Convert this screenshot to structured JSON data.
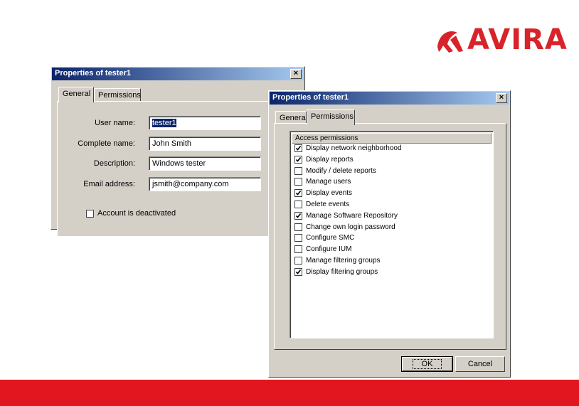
{
  "logo": {
    "text": "AVIRA",
    "brand_color": "#d8232a"
  },
  "footer": {
    "color": "#e2161e"
  },
  "dialog_general": {
    "title": "Properties of tester1",
    "close_label": "×",
    "tabs": [
      {
        "label": "General",
        "active": true
      },
      {
        "label": "Permissions",
        "active": false
      }
    ],
    "fields": [
      {
        "label": "User name:",
        "value": "tester1"
      },
      {
        "label": "Complete name:",
        "value": "John Smith"
      },
      {
        "label": "Description:",
        "value": "Windows tester"
      },
      {
        "label": "Email address:",
        "value": "jsmith@company.com"
      }
    ],
    "deactivated": {
      "label": "Account is deactivated",
      "checked": false
    }
  },
  "dialog_permissions": {
    "title": "Properties of tester1",
    "close_label": "×",
    "tabs": [
      {
        "label": "Genera",
        "active": false
      },
      {
        "label": "Permissions",
        "active": true
      }
    ],
    "list_header": "Access permissions",
    "permissions": [
      {
        "label": "Display network neighborhood",
        "checked": true
      },
      {
        "label": "Display reports",
        "checked": true
      },
      {
        "label": "Modify / delete reports",
        "checked": false
      },
      {
        "label": "Manage users",
        "checked": false
      },
      {
        "label": "Display events",
        "checked": true
      },
      {
        "label": "Delete events",
        "checked": false
      },
      {
        "label": "Manage Software Repository",
        "checked": true
      },
      {
        "label": "Change own login password",
        "checked": false
      },
      {
        "label": "Configure SMC",
        "checked": false
      },
      {
        "label": "Configure IUM",
        "checked": false
      },
      {
        "label": "Manage filtering groups",
        "checked": false
      },
      {
        "label": "Display filtering groups",
        "checked": true
      }
    ],
    "buttons": {
      "ok": "OK",
      "cancel": "Cancel"
    }
  }
}
